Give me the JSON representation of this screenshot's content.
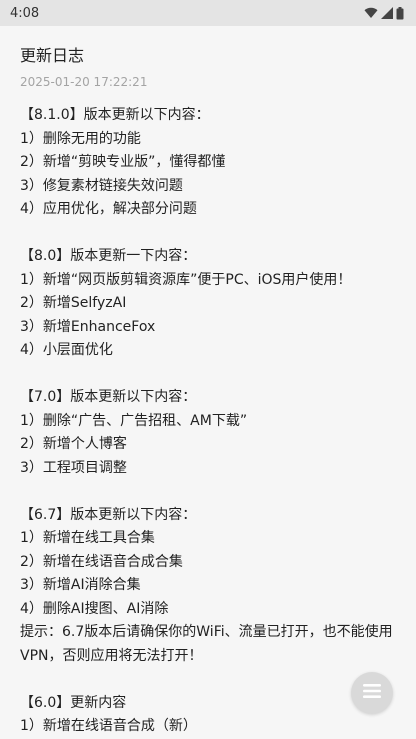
{
  "status_bar": {
    "time": "4:08"
  },
  "header": {
    "title": "更新日志",
    "date": "2025-01-20 17:22:21"
  },
  "log_lines": [
    "【8.1.0】版本更新以下内容：",
    "1）删除无用的功能",
    "2）新增“剪映专业版”，懂得都懂",
    "3）修复素材链接失效问题",
    "4）应用优化，解决部分问题",
    "",
    "【8.0】版本更新一下内容：",
    "1）新增“网页版剪辑资源库”便于PC、iOS用户使用！",
    "2）新增SelfyzAI",
    "3）新增EnhanceFox",
    "4）小层面优化",
    "",
    "【7.0】版本更新以下内容：",
    "1）删除“广告、广告招租、AM下载”",
    "2）新增个人博客",
    "3）工程项目调整",
    "",
    "【6.7】版本更新以下内容：",
    "1）新增在线工具合集",
    "2）新增在线语音合成合集",
    "3）新增AI消除合集",
    "4）删除AI搜图、AI消除",
    "提示：6.7版本后请确保你的WiFi、流量已打开，也不能使用VPN，否则应用将无法打开！",
    "",
    "【6.0】更新内容",
    "1）新增在线语音合成（新）"
  ],
  "icons": {
    "wifi": "wifi-icon",
    "signal": "signal-icon",
    "battery": "battery-icon",
    "menu": "menu-icon"
  },
  "colors": {
    "background": "#f6f6f6",
    "status_bar": "#e4e4e4",
    "date_text": "#a4a4a4",
    "fab": "#d9d9d9"
  }
}
